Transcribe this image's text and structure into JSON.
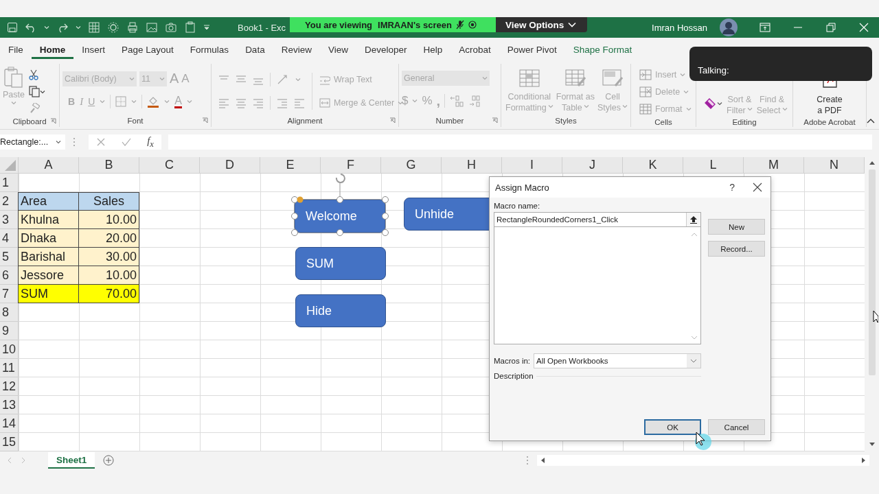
{
  "title_bar": {
    "document": "Book1 - Exc",
    "user": "Imran Hossan"
  },
  "screen_share": {
    "message": "You are viewing",
    "presenter": "IMRAAN's screen",
    "button": "View Options"
  },
  "talking": {
    "label": "Talking:"
  },
  "menu_tabs": [
    {
      "label": "File",
      "selected": false,
      "kind": "normal"
    },
    {
      "label": "Home",
      "selected": true,
      "kind": "normal"
    },
    {
      "label": "Insert",
      "selected": false,
      "kind": "normal"
    },
    {
      "label": "Page Layout",
      "selected": false,
      "kind": "normal"
    },
    {
      "label": "Formulas",
      "selected": false,
      "kind": "normal"
    },
    {
      "label": "Data",
      "selected": false,
      "kind": "normal"
    },
    {
      "label": "Review",
      "selected": false,
      "kind": "normal"
    },
    {
      "label": "View",
      "selected": false,
      "kind": "normal"
    },
    {
      "label": "Developer",
      "selected": false,
      "kind": "normal"
    },
    {
      "label": "Help",
      "selected": false,
      "kind": "normal"
    },
    {
      "label": "Acrobat",
      "selected": false,
      "kind": "normal"
    },
    {
      "label": "Power Pivot",
      "selected": false,
      "kind": "normal"
    },
    {
      "label": "Shape Format",
      "selected": false,
      "kind": "contextual"
    }
  ],
  "ribbon": {
    "clipboard": {
      "label": "Clipboard",
      "disabled": true,
      "paste": "Paste"
    },
    "font": {
      "label": "Font",
      "disabled": true,
      "font_name": "Calibri (Body)",
      "font_size": "11",
      "grow": "A",
      "shrink": "A",
      "bold": "B",
      "italic": "I",
      "underline": "U",
      "font_color": "A"
    },
    "alignment": {
      "label": "Alignment",
      "disabled": true,
      "wrap": "Wrap Text",
      "merge": "Merge & Center"
    },
    "number": {
      "label": "Number",
      "disabled": true,
      "format": "General",
      "currency": "$",
      "percent": "%",
      "comma": ","
    },
    "styles": {
      "label": "Styles",
      "disabled": true,
      "items": [
        {
          "lines": [
            "Conditional",
            "Formatting"
          ]
        },
        {
          "lines": [
            "Format as",
            "Table"
          ]
        },
        {
          "lines": [
            "Cell",
            "Styles"
          ]
        }
      ]
    },
    "cells": {
      "label": "Cells",
      "disabled": true,
      "items": [
        "Insert",
        "Delete",
        "Format"
      ]
    },
    "editing": {
      "label": "Editing",
      "disabled": true,
      "items": [
        {
          "lines": [
            "Sort &",
            "Filter"
          ]
        },
        {
          "lines": [
            "Find &",
            "Select"
          ]
        }
      ]
    },
    "acrobat": {
      "label": "Adobe Acrobat",
      "disabled": false,
      "lines": [
        "Create",
        "a PDF"
      ]
    }
  },
  "formula_bar": {
    "name_box": "Rectangle:...",
    "fx": "f$_{x}$"
  },
  "sheet": {
    "columns": [
      "A",
      "B",
      "C",
      "D",
      "E",
      "F",
      "G",
      "H",
      "I",
      "J",
      "K",
      "L",
      "M",
      "N"
    ],
    "rows": [
      "1",
      "2",
      "3",
      "4",
      "5",
      "6",
      "7",
      "8",
      "9",
      "10",
      "11",
      "12",
      "13",
      "14",
      "15"
    ],
    "table": [
      {
        "kind": "header",
        "cells": [
          "Area",
          "Sales"
        ]
      },
      {
        "kind": "data",
        "cells": [
          "Khulna",
          "10.00"
        ]
      },
      {
        "kind": "data",
        "cells": [
          "Dhaka",
          "20.00"
        ]
      },
      {
        "kind": "data",
        "cells": [
          "Barishal",
          "30.00"
        ]
      },
      {
        "kind": "data",
        "cells": [
          "Jessore",
          "10.00"
        ]
      },
      {
        "kind": "total",
        "cells": [
          "SUM",
          "70.00"
        ]
      }
    ]
  },
  "shapes": [
    {
      "text": "Welcome",
      "selected": true
    },
    {
      "text": "Unhide",
      "selected": false
    },
    {
      "text": "SUM",
      "selected": false
    },
    {
      "text": "Hide",
      "selected": false
    }
  ],
  "dialog": {
    "title": "Assign Macro",
    "help": "?",
    "macro_name_label": "Macro name:",
    "macro_name": "RectangleRoundedCorners1_Click",
    "new_button": "New",
    "record_button": "Record...",
    "macros_in_label": "Macros in:",
    "macros_in": "All Open Workbooks",
    "description_label": "Description",
    "ok_button": "OK",
    "cancel_button": "Cancel"
  },
  "sheet_tabs": [
    {
      "label": "Sheet1",
      "selected": true
    }
  ]
}
